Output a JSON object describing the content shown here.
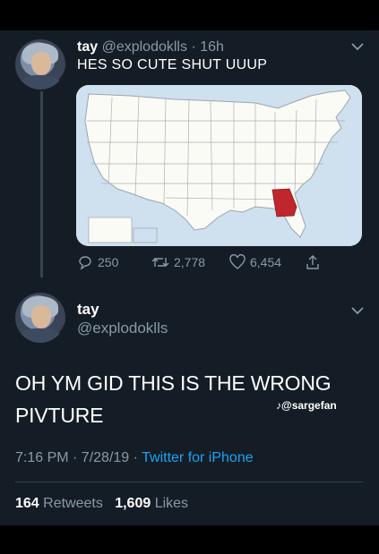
{
  "tweet1": {
    "name": "tay",
    "handle": "@explodoklls",
    "separator": "·",
    "time": "16h",
    "text": "HES SO CUTE SHUT UUUP",
    "map_highlight_color": "#c0262d",
    "actions": {
      "replies": "250",
      "retweets": "2,778",
      "likes": "6,454"
    }
  },
  "tweet2": {
    "name": "tay",
    "handle": "@explodoklls",
    "text_line1": "OH YM GID THIS IS THE WRONG",
    "text_line2": "PIVTURE",
    "watermark": "♪@sargefan",
    "time": "7:16 PM · 7/28/19 ·",
    "source": "Twitter for iPhone",
    "retweets_count": "164",
    "retweets_label": "Retweets",
    "likes_count": "1,609",
    "likes_label": "Likes"
  },
  "colors": {
    "background": "#141d26",
    "muted_text": "#8899a6",
    "link": "#1da1f2"
  }
}
